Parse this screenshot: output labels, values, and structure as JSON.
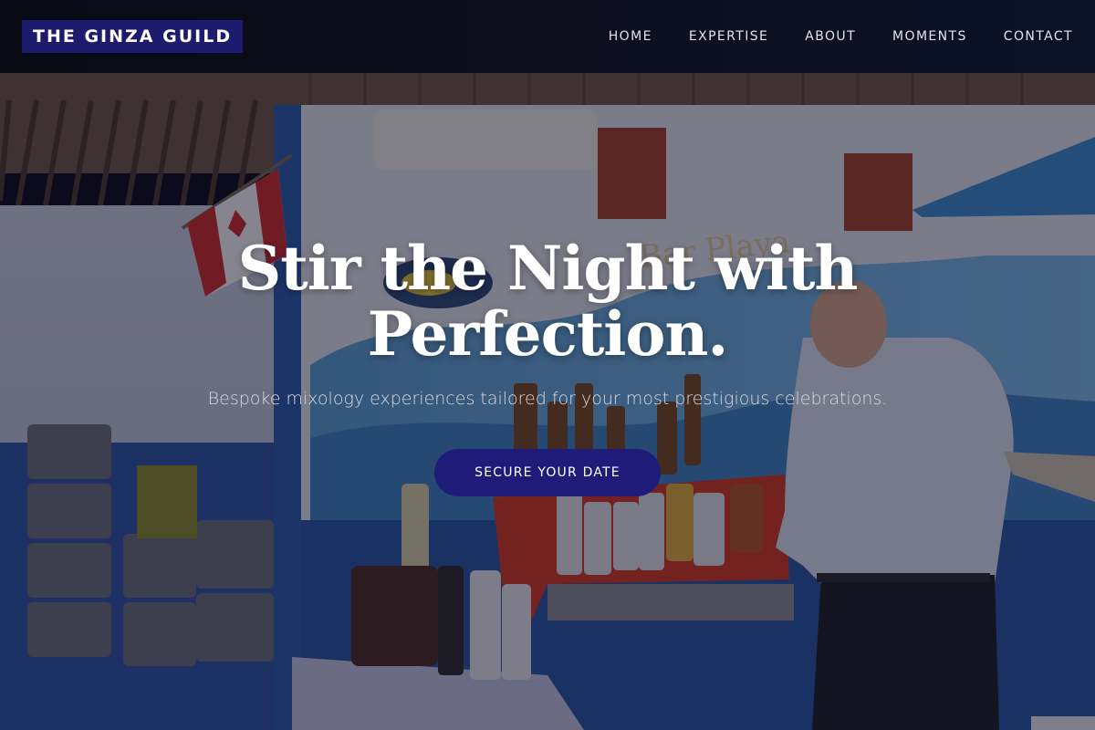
{
  "brand": {
    "name": "THE GINZA GUILD"
  },
  "nav": {
    "items": [
      {
        "label": "HOME"
      },
      {
        "label": "EXPERTISE"
      },
      {
        "label": "ABOUT"
      },
      {
        "label": "MOMENTS"
      },
      {
        "label": "CONTACT"
      }
    ]
  },
  "hero": {
    "title": "Stir the Night with Perfection.",
    "subtitle": "Bespoke mixology experiences tailored for your most prestigious celebrations.",
    "cta_label": "SECURE YOUR DATE",
    "photo_sign_text": "Bar Playa"
  },
  "colors": {
    "accent": "#1e1c78",
    "brand_bg": "#1c1b6e",
    "header_bg": "#0a0a14"
  }
}
